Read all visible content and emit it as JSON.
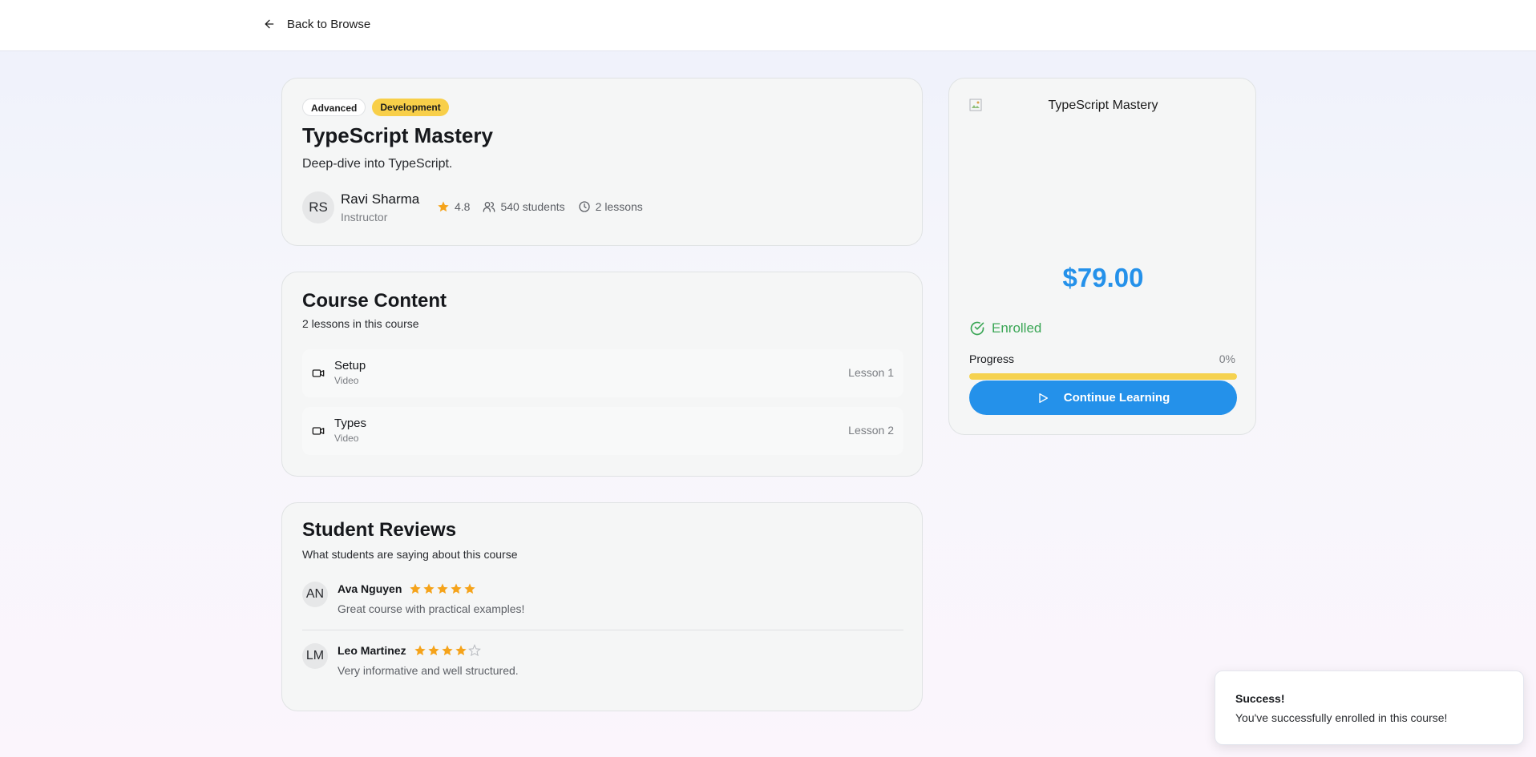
{
  "header": {
    "back_label": "Back to Browse",
    "back_icon": "arrow-left-icon"
  },
  "course": {
    "level": "Advanced",
    "category": "Development",
    "title": "TypeScript Mastery",
    "description": "Deep-dive into TypeScript.",
    "instructor": {
      "initials": "RS",
      "name": "Ravi Sharma",
      "role": "Instructor"
    },
    "rating": "4.8",
    "students": "540 students",
    "lessons_count": "2 lessons"
  },
  "content": {
    "title": "Course Content",
    "subtitle": "2 lessons in this course",
    "lessons": [
      {
        "name": "Setup",
        "type": "Video",
        "number": "Lesson 1"
      },
      {
        "name": "Types",
        "type": "Video",
        "number": "Lesson 2"
      }
    ]
  },
  "reviews": {
    "title": "Student Reviews",
    "subtitle": "What students are saying about this course",
    "items": [
      {
        "initials": "AN",
        "name": "Ava Nguyen",
        "rating": 5,
        "text": "Great course with practical examples!"
      },
      {
        "initials": "LM",
        "name": "Leo Martinez",
        "rating": 4,
        "text": "Very informative and well structured."
      }
    ]
  },
  "sidebar": {
    "image_alt": "TypeScript Mastery",
    "price": "$79.00",
    "status": "Enrolled",
    "progress_label": "Progress",
    "progress_text": "0%",
    "progress_value": 0,
    "cta_label": "Continue Learning"
  },
  "toast": {
    "title": "Success!",
    "message": "You've successfully enrolled in this course!"
  },
  "colors": {
    "accent": "#2491ea",
    "category_badge": "#f8cf49",
    "star": "#f5a31a",
    "success": "#3aa655"
  }
}
